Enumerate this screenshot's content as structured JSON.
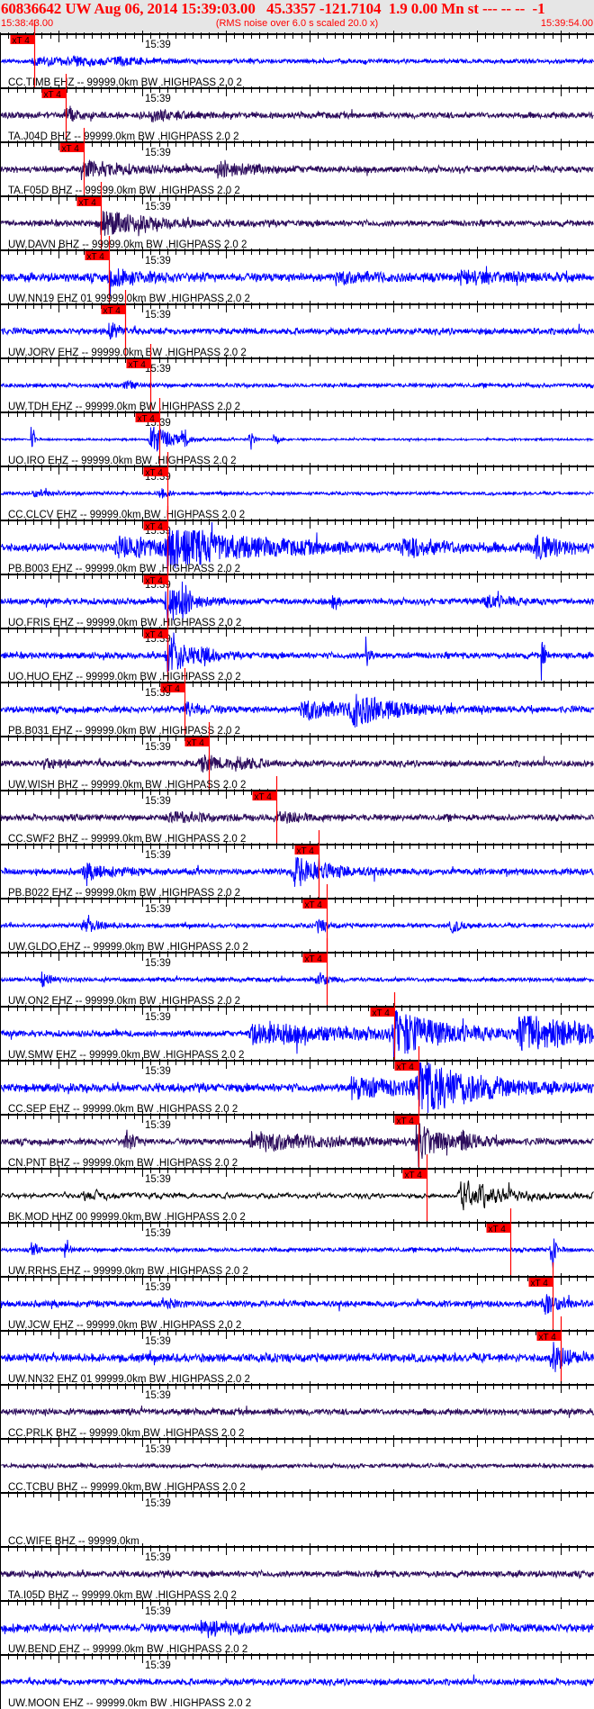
{
  "header": {
    "title": "60836642 UW Aug 06, 2014 15:39:03.00   45.3357 -121.7104  1.9 0.00 Mn st --- -- --  -1",
    "start_time": "15:38:43.00",
    "rms_note": "(RMS noise over 6.0 s scaled 20.0 x)",
    "end_time": "15:39:54.00"
  },
  "time_axis": {
    "span_seconds": 71,
    "minute_label": "15:39",
    "minute_offset_seconds": 17
  },
  "colors": {
    "title": "#ff0000",
    "pick": "#ff0000",
    "blue": "#0000ff",
    "purple": "#2c0c5c",
    "black": "#000000",
    "header_bg": "#e6e6e6"
  },
  "pick_label": "xT 4",
  "traces": [
    {
      "label": "CC.TIMB EHZ -- 99999.0km BW .HIGHPASS  2.0  2",
      "color": "blue",
      "pick_s": 4.1
    },
    {
      "label": "TA.J04D BHZ -- 99999.0km BW .HIGHPASS  2.0  2",
      "color": "purple",
      "pick_s": 7.9
    },
    {
      "label": "TA.F05D BHZ -- 99999.0km BW .HIGHPASS  2.0  2",
      "color": "purple",
      "pick_s": 10.0
    },
    {
      "label": "UW.DAVN BHZ -- 99999.0km BW .HIGHPASS  2.0  2",
      "color": "purple",
      "pick_s": 12.0
    },
    {
      "label": "UW.NN19 EHZ 01 99999.0km BW .HIGHPASS  2.0  2",
      "color": "blue",
      "pick_s": 13.0
    },
    {
      "label": "UW.JORV EHZ -- 99999.0km BW .HIGHPASS  2.0  2",
      "color": "blue",
      "pick_s": 15.0
    },
    {
      "label": "UW.TDH EHZ -- 99999.0km BW .HIGHPASS  2.0  2",
      "color": "blue",
      "pick_s": 18.0
    },
    {
      "label": "UO.IRO EHZ -- 99999.0km BW .HIGHPASS  2.0  2",
      "color": "blue",
      "pick_s": 19.0
    },
    {
      "label": "CC.CLCV EHZ -- 99999.0km BW .HIGHPASS  2.0  2",
      "color": "blue",
      "pick_s": 20.0
    },
    {
      "label": "PB.B003 EHZ -- 99999.0km BW .HIGHPASS  2.0  2",
      "color": "blue",
      "pick_s": 20.0
    },
    {
      "label": "UO.FRIS EHZ -- 99999.0km BW .HIGHPASS  2.0  2",
      "color": "blue",
      "pick_s": 20.0
    },
    {
      "label": "UO.HUO EHZ -- 99999.0km BW .HIGHPASS  2.0  2",
      "color": "blue",
      "pick_s": 20.0
    },
    {
      "label": "PB.B031 EHZ -- 99999.0km BW .HIGHPASS  2.0  2",
      "color": "blue",
      "pick_s": 22.1
    },
    {
      "label": "UW.WISH BHZ -- 99999.0km BW .HIGHPASS  2.0  2",
      "color": "purple",
      "pick_s": 25.0
    },
    {
      "label": "CC.SWF2 BHZ -- 99999.0km BW .HIGHPASS  2.0  2",
      "color": "purple",
      "pick_s": 33.0
    },
    {
      "label": "PB.B022 EHZ -- 99999.0km BW .HIGHPASS  2.0  2",
      "color": "blue",
      "pick_s": 38.1
    },
    {
      "label": "UW.GLDO EHZ -- 99999.0km BW .HIGHPASS  2.0  2",
      "color": "blue",
      "pick_s": 39.0
    },
    {
      "label": "UW.ON2 EHZ -- 99999.0km BW .HIGHPASS  2.0  2",
      "color": "blue",
      "pick_s": 39.0
    },
    {
      "label": "UW.SMW EHZ -- 99999.0km BW .HIGHPASS  2.0  2",
      "color": "blue",
      "pick_s": 47.1
    },
    {
      "label": "CC.SEP EHZ -- 99999.0km BW .HIGHPASS  2.0  2",
      "color": "blue",
      "pick_s": 50.0
    },
    {
      "label": "CN.PNT BHZ -- 99999.0km BW .HIGHPASS  2.0  2",
      "color": "purple",
      "pick_s": 50.0
    },
    {
      "label": "BK.MOD HHZ 00 99999.0km BW .HIGHPASS  2.0  2",
      "color": "black",
      "pick_s": 51.0
    },
    {
      "label": "UW.RRHS EHZ -- 99999.0km BW .HIGHPASS  2.0  2",
      "color": "blue",
      "pick_s": 61.0
    },
    {
      "label": "UW.JCW EHZ -- 99999.0km BW .HIGHPASS  2.0  2",
      "color": "blue",
      "pick_s": 66.0
    },
    {
      "label": "UW.NN32 EHZ 01 99999.0km BW .HIGHPASS  2.0  2",
      "color": "blue",
      "pick_s": 67.0
    },
    {
      "label": "CC.PRLK BHZ -- 99999.0km BW .HIGHPASS  2.0  2",
      "color": "purple",
      "pick_s": null
    },
    {
      "label": "CC.TCBU BHZ -- 99999.0km BW .HIGHPASS  2.0  2",
      "color": "purple",
      "pick_s": null
    },
    {
      "label": "CC.WIFE BHZ -- 99999.0km",
      "color": "purple",
      "pick_s": null
    },
    {
      "label": "TA.I05D BHZ -- 99999.0km BW .HIGHPASS  2.0  2",
      "color": "purple",
      "pick_s": null
    },
    {
      "label": "UW.BEND EHZ -- 99999.0km BW .HIGHPASS  2.0  2",
      "color": "blue",
      "pick_s": null
    },
    {
      "label": "UW.MOON EHZ -- 99999.0km BW .HIGHPASS  2.0  2",
      "color": "blue",
      "pick_s": null
    }
  ]
}
